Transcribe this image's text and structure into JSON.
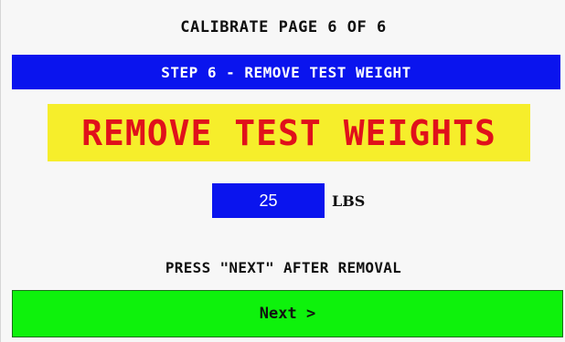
{
  "page": {
    "title": "CALIBRATE PAGE 6 OF 6"
  },
  "step": {
    "label": "STEP 6 - REMOVE TEST WEIGHT"
  },
  "banner": {
    "text": "REMOVE TEST WEIGHTS"
  },
  "weight": {
    "value": "25",
    "unit": "LBS"
  },
  "instruction": {
    "text": "PRESS \"NEXT\" AFTER REMOVAL"
  },
  "buttons": {
    "next_label": "Next >"
  },
  "colors": {
    "step_bar": "#0a14ee",
    "banner_bg": "#f6ee2b",
    "banner_text": "#e0111b",
    "weight_box": "#0a14ee",
    "next_button": "#0ef20c"
  }
}
